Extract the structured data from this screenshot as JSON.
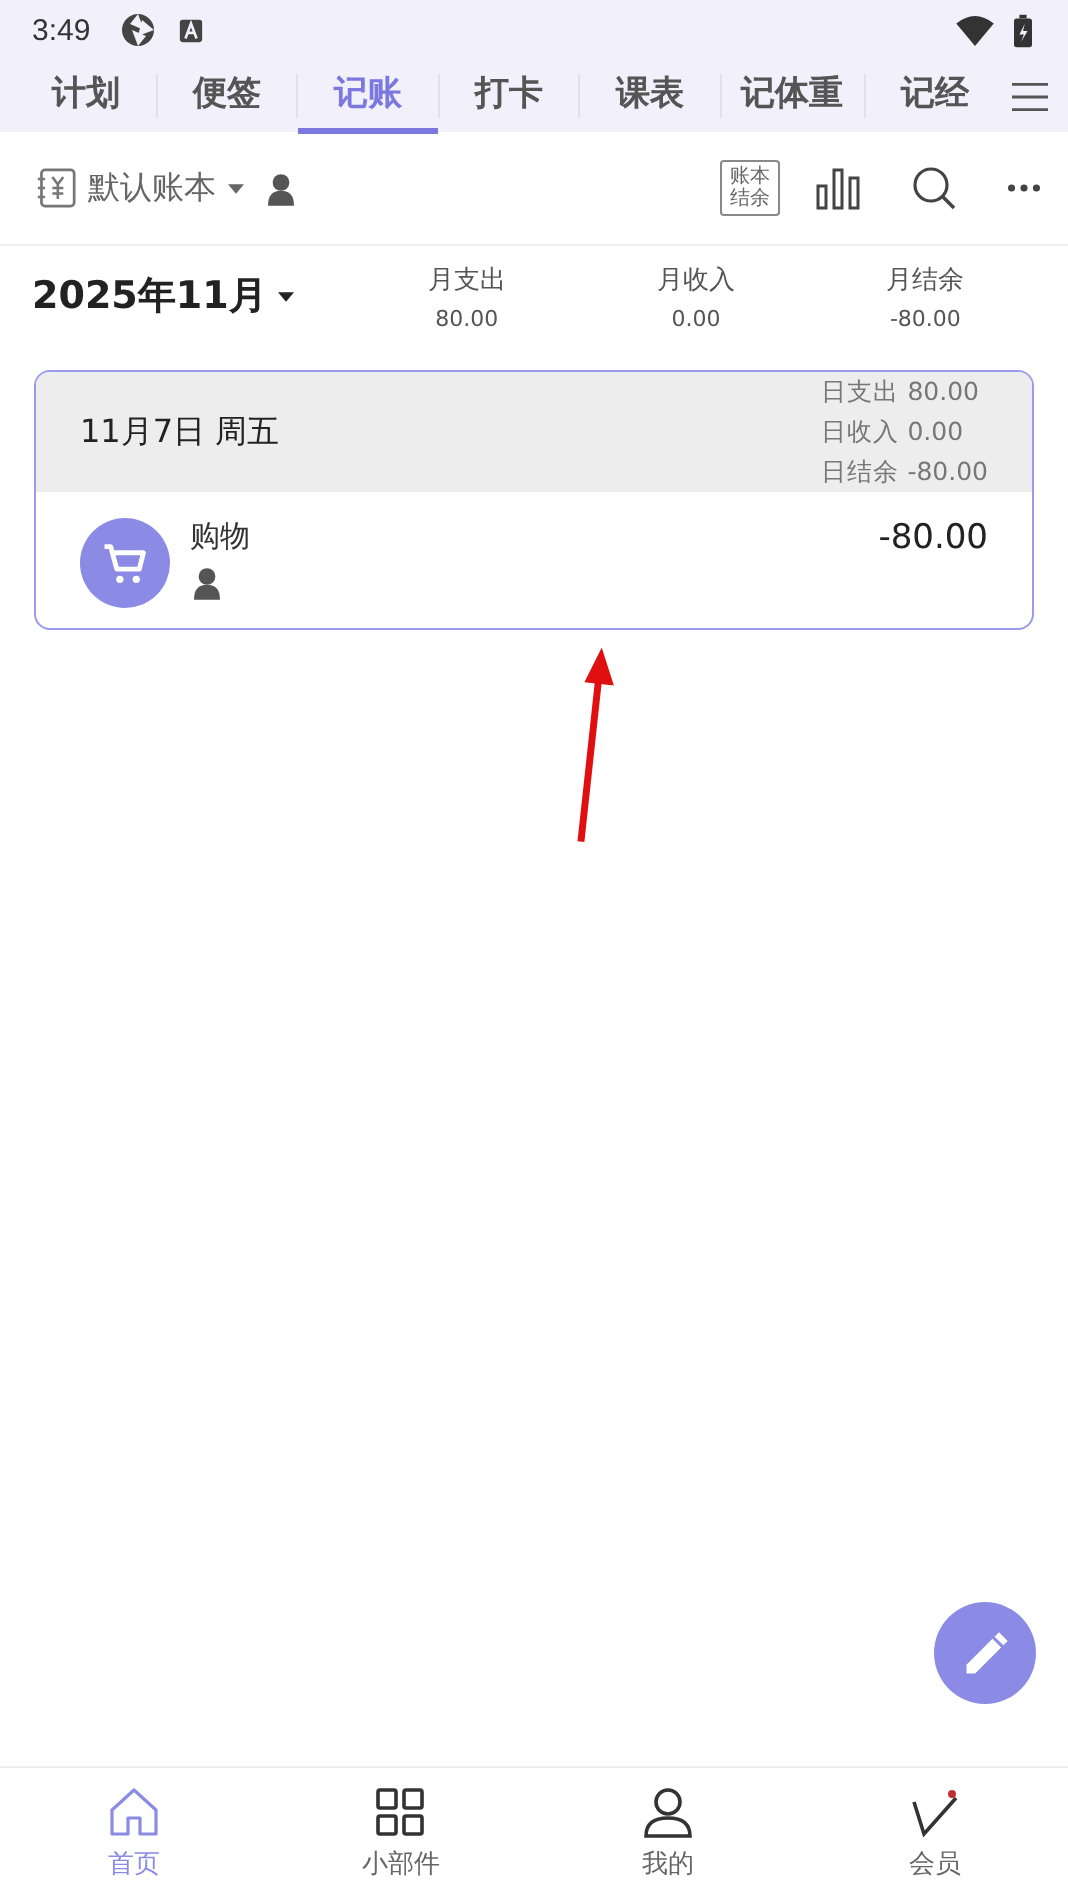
{
  "status_bar": {
    "time": "3:49"
  },
  "tabs": [
    {
      "label": "计划",
      "selected": false
    },
    {
      "label": "便签",
      "selected": false
    },
    {
      "label": "记账",
      "selected": true
    },
    {
      "label": "打卡",
      "selected": false
    },
    {
      "label": "课表",
      "selected": false
    },
    {
      "label": "记体重",
      "selected": false
    },
    {
      "label": "记经",
      "selected": false
    }
  ],
  "toolbar": {
    "book": "默认账本",
    "summary_button": "账本结余"
  },
  "month": {
    "label": "2025年11月",
    "stats": [
      {
        "label": "月支出",
        "value": "80.00"
      },
      {
        "label": "月收入",
        "value": "0.00"
      },
      {
        "label": "月结余",
        "value": "-80.00"
      }
    ]
  },
  "days": [
    {
      "date": "11月7日 周五",
      "totals": [
        "日支出 80.00",
        "日收入 0.00",
        "日结余 -80.00"
      ],
      "entries": [
        {
          "category": "购物",
          "amount": "-80.00"
        }
      ]
    }
  ],
  "bottom_nav": [
    {
      "label": "首页",
      "selected": true,
      "kind": "home"
    },
    {
      "label": "小部件",
      "selected": false,
      "kind": "widgets"
    },
    {
      "label": "我的",
      "selected": false,
      "kind": "profile"
    },
    {
      "label": "会员",
      "selected": false,
      "kind": "vip"
    }
  ]
}
